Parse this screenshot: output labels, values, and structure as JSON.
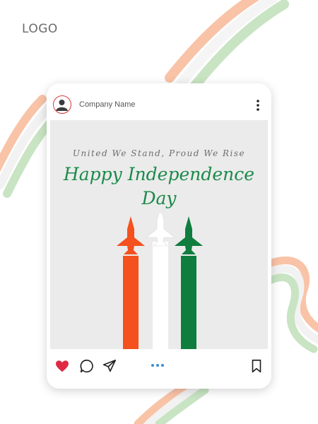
{
  "brand": {
    "logo_text": "LOGO"
  },
  "post": {
    "company_name": "Company Name",
    "tagline": "United We Stand, Proud We Rise",
    "headline_line1": "Happy Independence",
    "headline_line2": "Day"
  },
  "icons": {
    "avatar": "user-avatar-icon",
    "more": "vertical-dots-icon",
    "like": "heart-icon",
    "comment": "comment-bubble-icon",
    "share": "send-icon",
    "save": "bookmark-icon"
  },
  "colors": {
    "saffron": "#f4511e",
    "white": "#ffffff",
    "green": "#0e7d3d",
    "heart": "#e02a45",
    "carousel_dot": "#3a8fd6"
  }
}
